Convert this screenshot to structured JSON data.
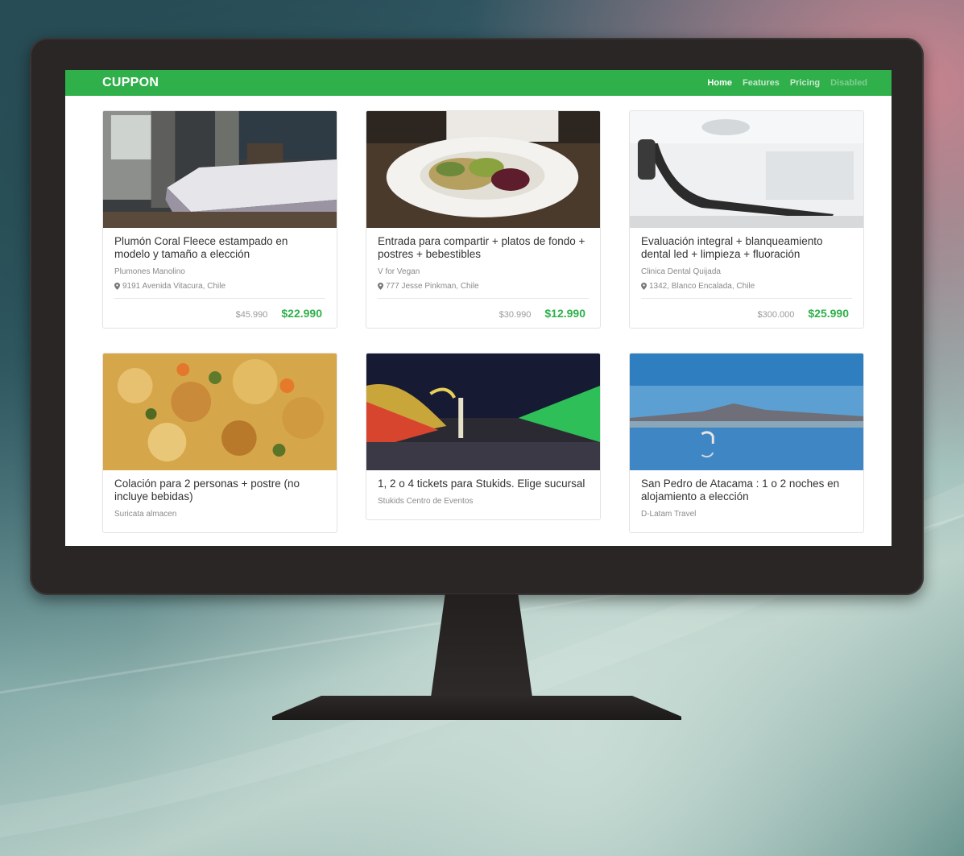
{
  "brand": "CUPPON",
  "nav": {
    "home": "Home",
    "features": "Features",
    "pricing": "Pricing",
    "disabled": "Disabled"
  },
  "colors": {
    "accent": "#2fb04b",
    "text": "#333333",
    "muted": "#8a8a8a"
  },
  "deals": [
    {
      "title": "Plumón Coral Fleece estampado en modelo y tamaño a elección",
      "merchant": "Plumones Manolino",
      "location": "9191 Avenida Vitacura, Chile",
      "old_price": "$45.990",
      "price": "$22.990",
      "image": "bedroom-photo"
    },
    {
      "title": "Entrada para compartir + platos de fondo + postres + bebestibles",
      "merchant": "V for Vegan",
      "location": "777 Jesse Pinkman, Chile",
      "old_price": "$30.990",
      "price": "$12.990",
      "image": "salad-plate-photo"
    },
    {
      "title": "Evaluación integral + blanqueamiento dental led + limpieza + fluoración",
      "merchant": "Clinica Dental Quijada",
      "location": "1342, Blanco Encalada, Chile",
      "old_price": "$300.000",
      "price": "$25.990",
      "image": "dental-chair-photo"
    },
    {
      "title": "Colación para 2 personas + postre (no incluye bebidas)",
      "merchant": "Suricata almacen",
      "image": "chickpea-stew-photo"
    },
    {
      "title": "1, 2 o 4 tickets para Stukids. Elige sucursal",
      "merchant": "Stukids Centro de Eventos",
      "image": "fair-night-photo"
    },
    {
      "title": "San Pedro de Atacama : 1 o 2 noches en alojamiento a elección",
      "merchant": "D-Latam Travel",
      "image": "salt-lake-flamingo-photo"
    }
  ]
}
